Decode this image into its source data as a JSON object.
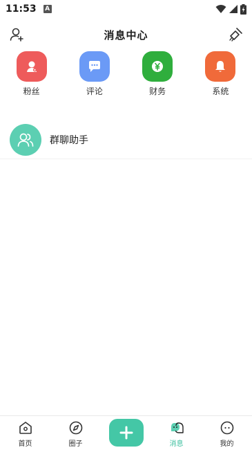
{
  "status_bar": {
    "time": "11:53",
    "notification_glyph": "A"
  },
  "header": {
    "title": "消息中心",
    "left_icon": "add-user-icon",
    "right_icon": "broom-icon"
  },
  "categories": [
    {
      "label": "粉丝",
      "icon": "fan-icon",
      "color": "#ee5b5b"
    },
    {
      "label": "评论",
      "icon": "comment-icon",
      "color": "#6b9af6"
    },
    {
      "label": "财务",
      "icon": "yuan-icon",
      "color": "#2fae3d"
    },
    {
      "label": "系统",
      "icon": "bell-icon",
      "color": "#f06a3a"
    }
  ],
  "chats": [
    {
      "name": "群聊助手",
      "icon": "group-icon",
      "color": "#5ccfb2"
    }
  ],
  "bottom_nav": {
    "items": [
      {
        "label": "首页",
        "icon": "home-icon"
      },
      {
        "label": "圈子",
        "icon": "compass-icon"
      },
      {
        "label": "消息",
        "icon": "message-icon",
        "active": true
      },
      {
        "label": "我的",
        "icon": "profile-icon"
      }
    ],
    "add_icon": "plus-icon",
    "accent": "#44c7a6"
  }
}
